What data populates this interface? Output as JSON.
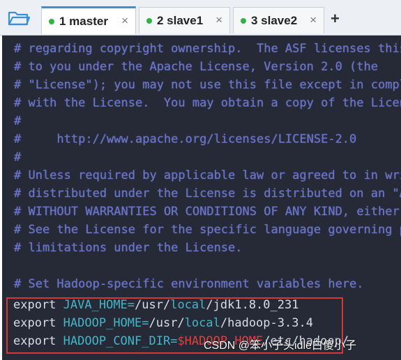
{
  "tabs": [
    {
      "label": "1 master",
      "close": "×"
    },
    {
      "label": "2 slave1",
      "close": "×"
    },
    {
      "label": "3 slave2",
      "close": "×"
    }
  ],
  "new_tab": "+",
  "lines": [
    "# regarding copyright ownership.  The ASF licenses this",
    "# to you under the Apache License, Version 2.0 (the",
    "# \"License\"); you may not use this file except in complia",
    "# with the License.  You may obtain a copy of the Licens",
    "#",
    "#     http://www.apache.org/licenses/LICENSE-2.0",
    "#",
    "# Unless required by applicable law or agreed to in writi",
    "# distributed under the License is distributed on an \"AS",
    "# WITHOUT WARRANTIES OR CONDITIONS OF ANY KIND, either e",
    "# See the License for the specific language governing pe",
    "# limitations under the License.",
    "",
    "# Set Hadoop-specific environment variables here."
  ],
  "exports": [
    {
      "keyword": "export",
      "var": "JAVA_HOME=",
      "p1": "/usr/",
      "local": "local",
      "p2": "/jdk1.8.0_231"
    },
    {
      "keyword": "export",
      "var": "HADOOP_HOME=",
      "p1": "/usr/",
      "local": "local",
      "p2": "/hadoop-3.3.4"
    },
    {
      "keyword": "export",
      "var": "HADOOP_CONF_DIR=",
      "ref": "$HADOOP_HOME",
      "p2": "/etc/hadoop/"
    }
  ],
  "watermark": "CSDN @笨小子头idle白傻小子",
  "colors": {
    "terminal_bg": "#262a36",
    "comment": "#6a74c8",
    "variable": "#43b6c8",
    "highlight": "#d23a3a"
  }
}
